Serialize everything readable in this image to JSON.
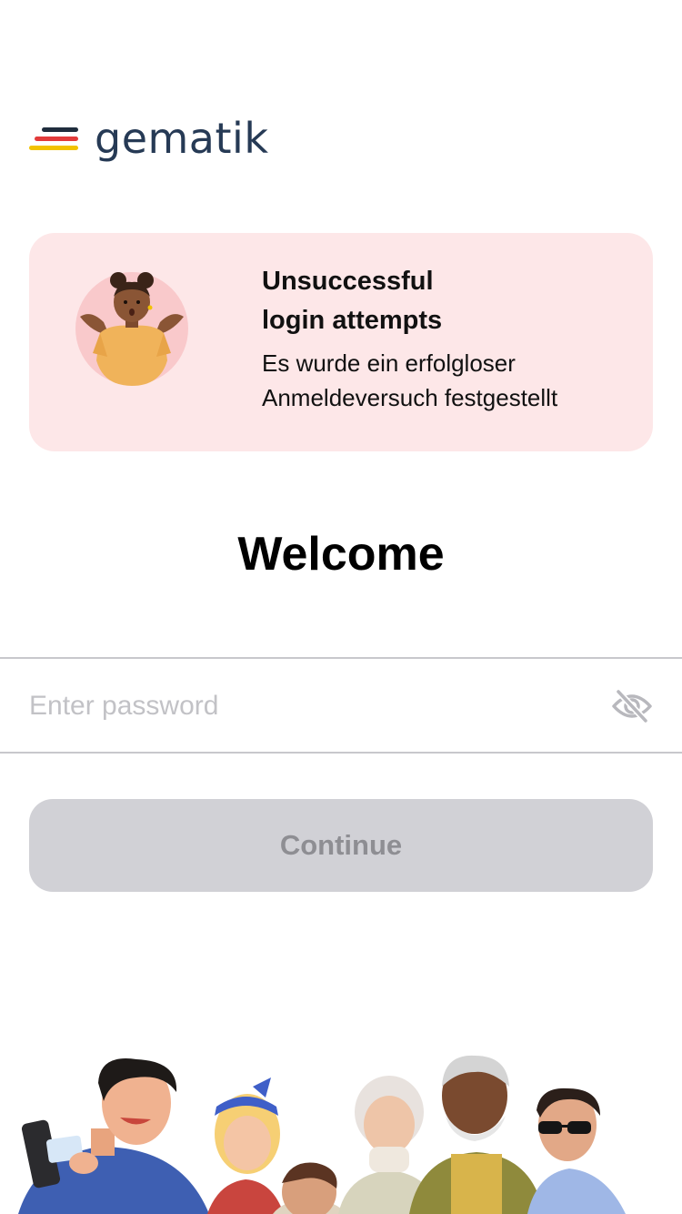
{
  "brand": {
    "name": "gematik",
    "colors": {
      "black": "#1f2d3d",
      "red": "#e23b3b",
      "gold": "#f2c200",
      "text": "#263a55"
    }
  },
  "alert": {
    "title_line1": "Unsuccessful",
    "title_line2": "login attempts",
    "description_line1": "Es wurde ein erfolgloser",
    "description_line2": "Anmeldeversuch festgestellt",
    "background": "#fde7e8",
    "illustration": "shrugging-person-illustration"
  },
  "welcome": {
    "title": "Welcome"
  },
  "password": {
    "placeholder": "Enter password",
    "value": "",
    "toggle_icon": "eye-slash-icon"
  },
  "continue_button": {
    "label": "Continue",
    "enabled": false
  },
  "footer": {
    "illustration": "group-of-people-illustration"
  }
}
